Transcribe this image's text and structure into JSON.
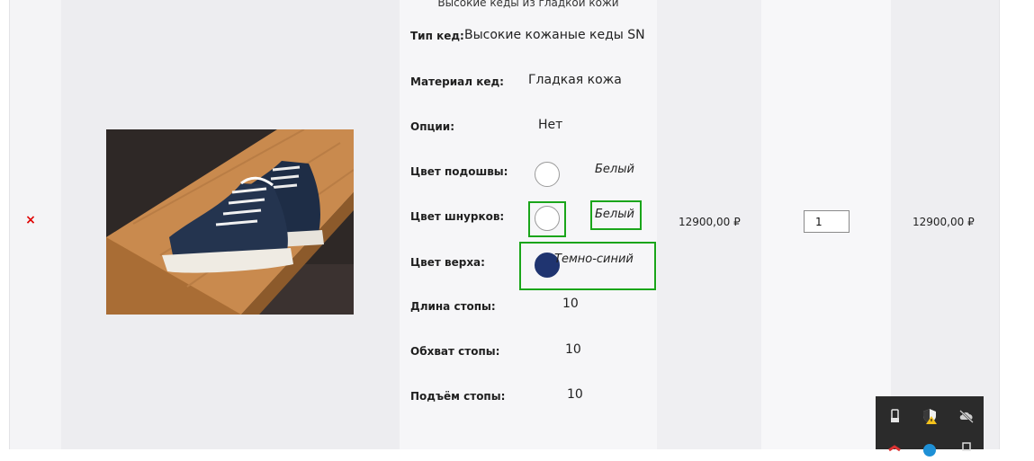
{
  "product": {
    "subtitle": "Высокие кеды из гладкой кожи",
    "remove_label": "×",
    "image_name": "sneakers-photo"
  },
  "options": [
    {
      "label": "Тип кед:",
      "value": "Высокие кожаные кеды SN"
    },
    {
      "label": "Материал кед:",
      "value": "Гладкая кожа"
    },
    {
      "label": "Опции:",
      "value": "Нет"
    },
    {
      "label": "Цвет подошвы:",
      "value": "Белый",
      "swatch": "#ffffff"
    },
    {
      "label": "Цвет шнурков:",
      "value": "Белый",
      "swatch": "#ffffff"
    },
    {
      "label": "Цвет верха:",
      "value": "Темно-синий",
      "swatch": "#1f3470"
    },
    {
      "label": "Длина стопы:",
      "value": "10"
    },
    {
      "label": "Обхват стопы:",
      "value": "10"
    },
    {
      "label": "Подъём стопы:",
      "value": "10"
    }
  ],
  "price": "12900,00 ₽",
  "quantity": "1",
  "total": "12900,00 ₽",
  "colors": {
    "highlight": "#1aa51a",
    "remove": "#e00000",
    "navy": "#1f3470"
  },
  "tray": {
    "icons": [
      "usb-icon",
      "shield-warning-icon",
      "cloud-off-icon",
      "red-app-icon",
      "blue-app-icon",
      "printer-icon"
    ]
  }
}
